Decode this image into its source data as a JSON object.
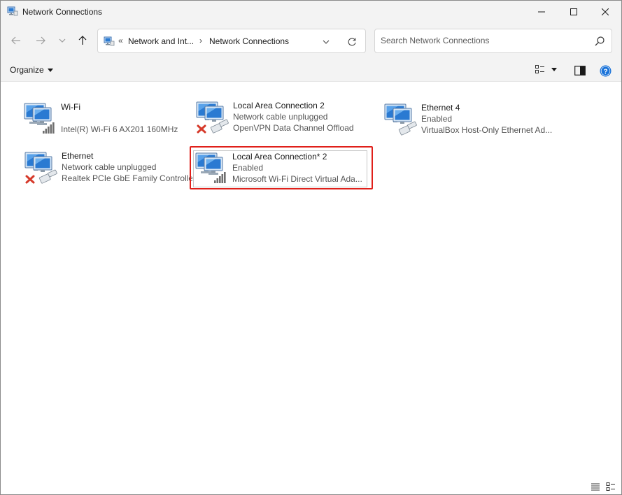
{
  "window": {
    "title": "Network Connections",
    "title_icon": "network-connections-icon"
  },
  "address": {
    "overflow_chevron": "«",
    "crumb1": "Network and Int...",
    "separator": "›",
    "crumb2": "Network Connections"
  },
  "search": {
    "placeholder": "Search Network Connections"
  },
  "toolbar": {
    "organize_label": "Organize"
  },
  "connections": [
    {
      "name": "Wi-Fi",
      "line1": "",
      "line2": "Intel(R) Wi-Fi 6 AX201 160MHz",
      "status_icon": "wifi-signal-icon"
    },
    {
      "name": "Local Area Connection 2",
      "line1": "Network cable unplugged",
      "line2": "OpenVPN Data Channel Offload",
      "status_icon": "disconnected-cable-icon"
    },
    {
      "name": "Ethernet 4",
      "line1": "Enabled",
      "line2": "VirtualBox Host-Only Ethernet Ad...",
      "status_icon": "ethernet-cable-icon"
    },
    {
      "name": "Ethernet",
      "line1": "Network cable unplugged",
      "line2": "Realtek PCIe GbE Family Controller",
      "status_icon": "disconnected-cable-icon"
    },
    {
      "name": "Local Area Connection* 2",
      "line1": "Enabled",
      "line2": "Microsoft Wi-Fi Direct Virtual Ada...",
      "status_icon": "wifi-signal-icon",
      "selected": true
    }
  ],
  "colors": {
    "highlight": "#e0201a",
    "accent": "#0067c0",
    "monitor": "#2a7ad2"
  }
}
